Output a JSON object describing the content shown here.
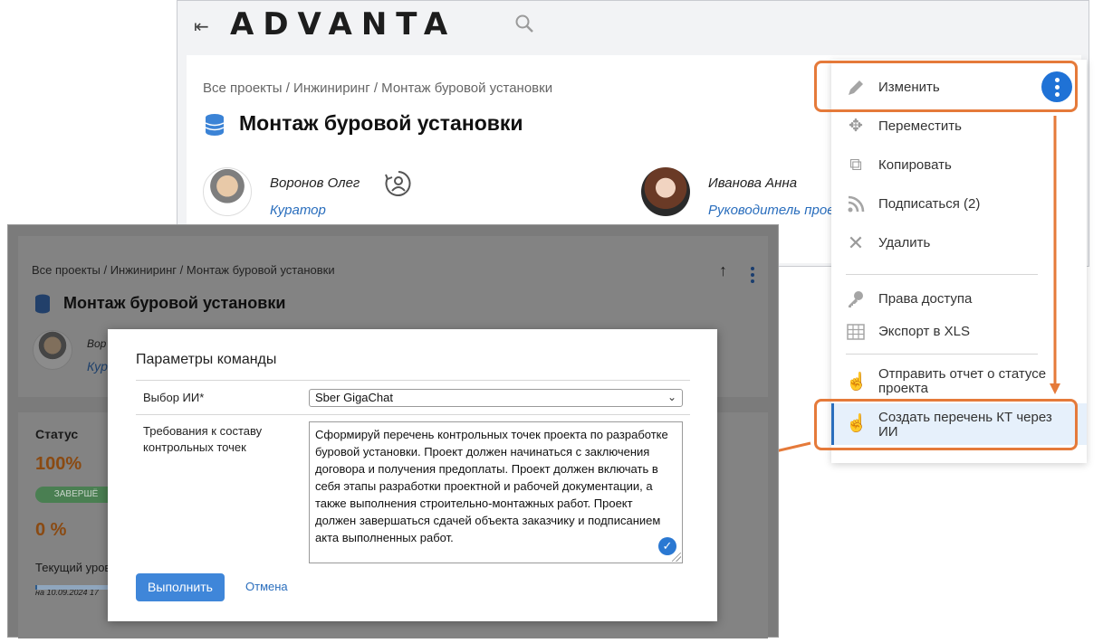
{
  "back": {
    "logo": "ADVANTA",
    "breadcrumb": "Все проекты / Инжиниринг / Монтаж буровой установки",
    "title": "Монтаж буровой установки",
    "people": [
      {
        "name": "Воронов Олег",
        "role": "Куратор"
      },
      {
        "name": "Иванова Анна",
        "role": "Руководитель прое"
      }
    ]
  },
  "menu": {
    "items": [
      {
        "label": "Изменить",
        "icon": "pencil-icon"
      },
      {
        "label": "Переместить",
        "icon": "move-icon"
      },
      {
        "label": "Копировать",
        "icon": "copy-icon"
      },
      {
        "label": "Подписаться (2)",
        "icon": "rss-icon"
      },
      {
        "label": "Удалить",
        "icon": "close-icon"
      },
      {
        "label": "Права доступа",
        "icon": "key-icon"
      },
      {
        "label": "Экспорт в XLS",
        "icon": "table-icon"
      },
      {
        "label": "Отправить отчет о статусе проекта",
        "icon": "pointer-icon"
      },
      {
        "label": "Создать перечень КТ через ИИ",
        "icon": "pointer-icon"
      }
    ]
  },
  "front": {
    "breadcrumb": "Все проекты / Инжиниринг / Монтаж буровой установки",
    "title": "Монтаж буровой установки",
    "person_name": "Вор",
    "person_role": "Кура",
    "status_label": "Статус",
    "percent1": "100%",
    "badge": "ЗАВЕРШЁ",
    "percent2": "0 %",
    "level_label": "Текущий уров",
    "date": "на 10.09.2024 17"
  },
  "modal": {
    "title": "Параметры команды",
    "ai_label": "Выбор ИИ*",
    "ai_value": "Sber GigaChat",
    "req_label": "Требования к составу контрольных точек",
    "req_value": "Сформируй перечень контрольных точек проекта по разработке буровой установки. Проект должен начинаться с заключения договора и получения предоплаты. Проект должен включать в себя этапы разработки проектной и рабочей документации, а также выполнения строительно-монтажных работ. Проект должен завершаться сдачей объекта заказчику и подписанием акта выполненных работ.",
    "run": "Выполнить",
    "cancel": "Отмена"
  },
  "colors": {
    "accent": "#e57a3a",
    "primary": "#2a6ebd"
  }
}
